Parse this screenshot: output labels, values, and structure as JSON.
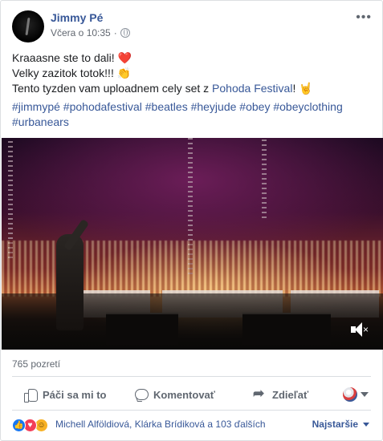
{
  "post": {
    "author": "Jimmy Pé",
    "timestamp": "Včera o 10:35",
    "separator": "·",
    "privacy_icon": "globe-icon",
    "more_label": "•••",
    "lines": {
      "line1": "Kraaasne ste to dali!",
      "line1_emoji": "❤️",
      "line2": "Velky zazitok totok!!!",
      "line2_emoji": "👏",
      "line3_prefix": "Tento tyzden vam uploadnem cely set z",
      "line3_link": "Pohoda Festival",
      "line3_suffix": "!",
      "line3_emoji": "🤘"
    },
    "hashtags_line1": "#jimmypé #pohodafestival #beatles #heyjude #obey #obeyclothing",
    "hashtags_line2": "#urbanears"
  },
  "video": {
    "muted_icon": "speaker-muted-icon"
  },
  "stats": {
    "views": "765 pozretí"
  },
  "actions": {
    "like": "Páči sa mi to",
    "comment": "Komentovať",
    "share": "Zdieľať"
  },
  "reactions": {
    "icons": [
      "like-icon",
      "love-icon",
      "haha-icon"
    ],
    "names": "Michell Alföldiová, Klárka Brídiková a 103 ďalších",
    "sort_label": "Najstaršie"
  },
  "colors": {
    "link": "#385898",
    "secondary": "#606770",
    "like_blue": "#1877f2",
    "love_red": "#f33e58",
    "haha_yellow": "#f7b125"
  }
}
